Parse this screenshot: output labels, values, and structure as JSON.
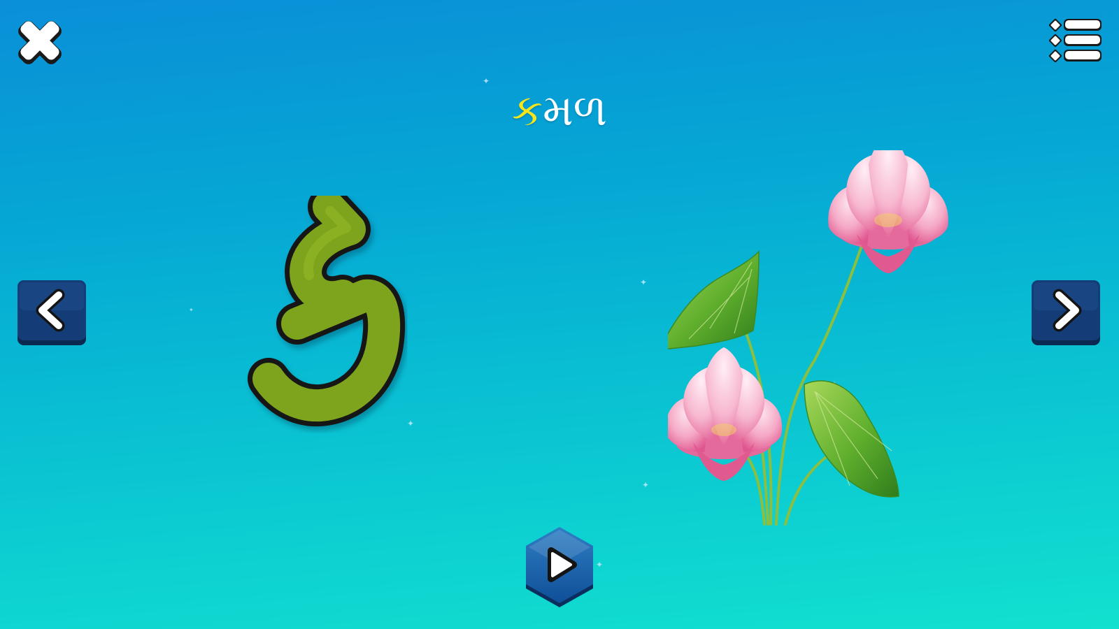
{
  "toolbar": {
    "close_icon": "close-x-icon",
    "menu_icon": "list-menu-icon"
  },
  "lesson": {
    "letter": "ક",
    "word_first_letter": "ક",
    "word_rest": "મળ",
    "picture": "lotus"
  },
  "navigation": {
    "prev_icon": "chevron-left-icon",
    "next_icon": "chevron-right-icon",
    "play_icon": "play-icon"
  },
  "colors": {
    "background_top": "#0a8fd8",
    "background_bottom": "#12e1cf",
    "letter_fill": "#7ea31a",
    "word_highlight": "#f5e51b",
    "button_navy": "#143d77"
  }
}
